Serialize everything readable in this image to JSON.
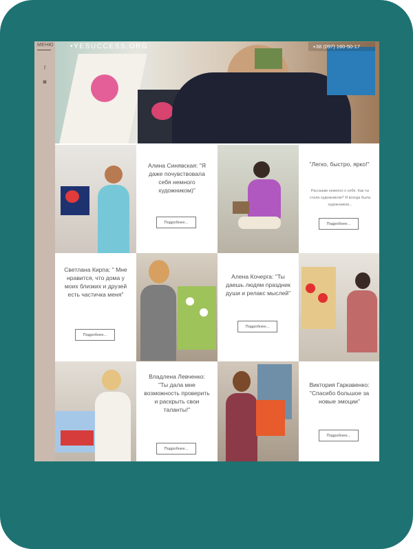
{
  "sidebar": {
    "menu_label": "МЕНЮ",
    "icons": [
      {
        "name": "facebook-icon",
        "glyph": "f"
      },
      {
        "name": "instagram-icon",
        "glyph": "◙"
      }
    ]
  },
  "header": {
    "logo": "•YESUCCESS.ORG",
    "phone": "+38 (097) 160-50-17"
  },
  "testimonials": [
    {
      "quote": "Алина Синявская: \"Я даже почувствовала себя немного художником)\"",
      "button": "Подробнее..."
    },
    {
      "quote": "\"Легко, быстро, ярко!\"",
      "subtext": "Расскажи немного о себе. Как ты стала художником? Я всегда была художником...",
      "button": "Подробнее..."
    },
    {
      "quote": "Светлана Кирпа: \" Мне нравится, что дома у моих близких и друзей есть частичка меня\"",
      "button": "Подробнее..."
    },
    {
      "quote": "Алена Кочерга: \"Ты даешь людям праздник души и релакс мыслей\"",
      "button": "Подробнее..."
    },
    {
      "quote": "Владлена Левченко: \"Ты дала мне возможность проверить и раскрыть свои таланты!\"",
      "button": "Подробнее..."
    },
    {
      "quote": "Виктория Гаркавенко: \"Спасибо большое за новые эмоции\"",
      "button": "Подробнее..."
    }
  ],
  "colors": {
    "frame": "#1e7272",
    "rail": "#c9b9ae",
    "card": "#ffffff"
  }
}
